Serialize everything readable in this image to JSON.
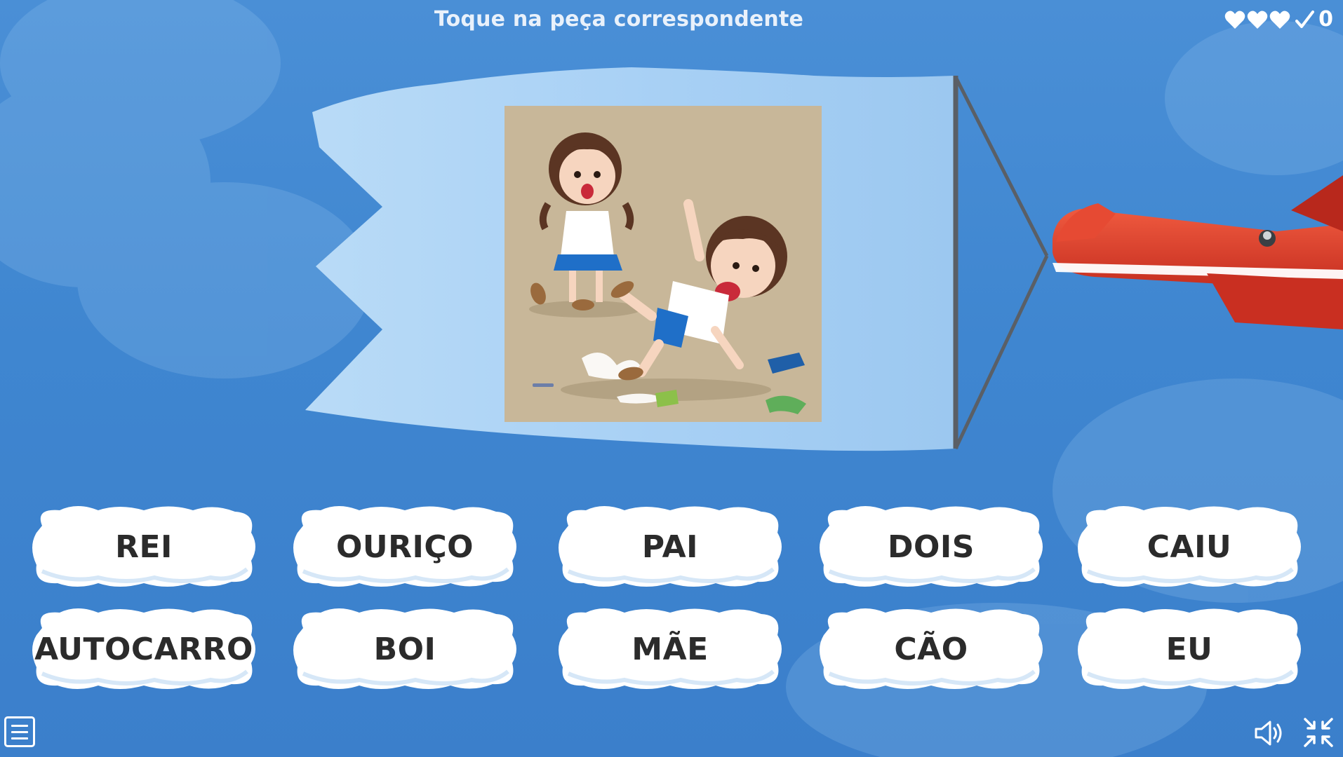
{
  "header": {
    "instruction": "Toque na peça correspondente",
    "lives_icons": [
      "heart-icon",
      "heart-icon",
      "heart-icon"
    ],
    "check_icon": "check-icon",
    "score": "0"
  },
  "scene": {
    "image_icon": "children-slipping-illustration"
  },
  "answers": [
    {
      "label": "REI"
    },
    {
      "label": "OURIÇO"
    },
    {
      "label": "PAI"
    },
    {
      "label": "DOIS"
    },
    {
      "label": "CAIU"
    },
    {
      "label": "AUTOCARRO"
    },
    {
      "label": "BOI"
    },
    {
      "label": "MÃE"
    },
    {
      "label": "CÃO"
    },
    {
      "label": "EU"
    }
  ],
  "footer": {
    "menu_icon": "menu-icon",
    "sound_icon": "speaker-icon",
    "fullscreen_icon": "exit-fullscreen-icon"
  },
  "colors": {
    "sky": "#3f86d0",
    "banner": "#a8d0f4",
    "plane": "#d93a2a",
    "cloud": "#ffffff",
    "text": "#2b2b2b"
  }
}
